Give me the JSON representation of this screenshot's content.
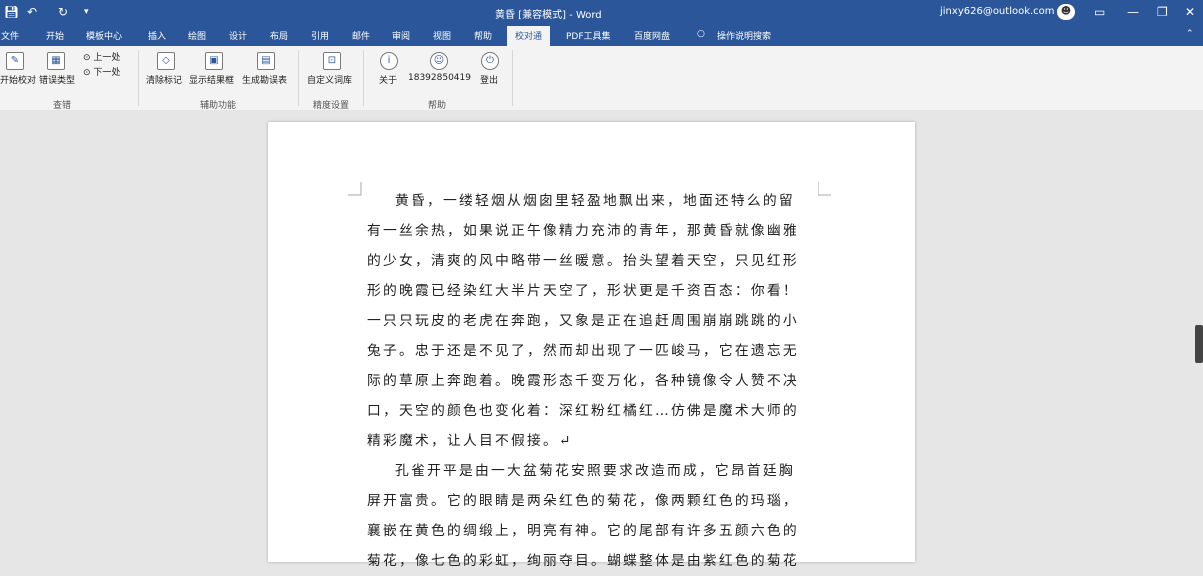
{
  "titlebar": {
    "save_icon": "save-icon",
    "undo_icon": "undo-icon",
    "redo_icon": "redo-icon",
    "customize_icon": "customize-icon",
    "title": "黄昏 [兼容模式] - Word",
    "account": "jinxy626@outlook.com",
    "avatar": "☻"
  },
  "tabs": [
    "文件",
    "开始",
    "模板中心",
    "插入",
    "绘图",
    "设计",
    "布局",
    "引用",
    "邮件",
    "审阅",
    "视图",
    "帮助",
    "校对通",
    "PDF工具集",
    "百度网盘",
    "操作说明搜索"
  ],
  "active_tab": "校对通",
  "ribbon": {
    "buttons": {
      "start_check": "开始校对",
      "error_type": "错误类型",
      "prev": "上一处",
      "next": "下一处",
      "clear_marks": "清除标记",
      "show_result": "显示结果框",
      "gen_report": "生成勘误表",
      "custom_dict": "自定义词库",
      "about": "关于",
      "phone": "18392850419",
      "logout": "登出"
    },
    "groups": {
      "check": "查错",
      "assist": "辅助功能",
      "precision": "精度设置",
      "help": "帮助"
    }
  },
  "document": {
    "para1": [
      "黄昏，一缕轻烟从烟囱里轻盈地飘出来，地面还特么的留",
      "有一丝余热，如果说正午像精力充沛的青年，那黄昏就像幽雅",
      "的少女，清爽的风中略带一丝暖意。抬头望着天空，只见红形",
      "形的晚霞已经染红大半片天空了，形状更是千资百态：你看！",
      "一只只玩皮的老虎在奔跑，又象是正在追赶周围崩崩跳跳的小",
      "兔子。忠于还是不见了，然而却出现了一匹峻马，它在遗忘无",
      "际的草原上奔跑着。晚霞形态千变万化，各种镜像令人赞不决",
      "口，天空的颜色也变化着：深红粉红橘红…仿佛是魔术大师的",
      "精彩魔术，让人目不假接。↵"
    ],
    "para2": [
      "孔雀开平是由一大盆菊花安照要求改造而成，它昂首廷胸",
      "屏开富贵。它的眼睛是两朵红色的菊花，像两颗红色的玛瑙，",
      "襄嵌在黄色的绸缎上，明亮有神。它的尾部有许多五颜六色的",
      "菊花，像七色的彩虹，绚丽夺目。蝴蝶整体是由紫红色的菊花"
    ]
  },
  "colors": {
    "brand": "#2b579a",
    "ribbon_bg": "#f3f3f3",
    "doc_bg": "#e6e6e6"
  }
}
